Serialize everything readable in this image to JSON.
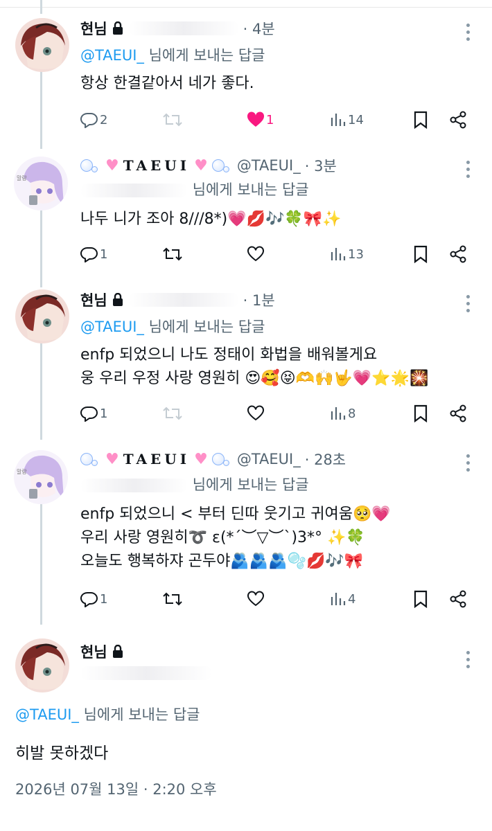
{
  "posts": [
    {
      "name": "현님",
      "time": "· 4분",
      "reply_to": "@TAEUI_",
      "reply_suffix": " 님에게 보내는 답글",
      "body": [
        "항상 한결같아서     네가 좋다."
      ],
      "replies": "2",
      "retweets": "",
      "likes": "1",
      "views": "14"
    },
    {
      "handle": "@TAEUI_",
      "time": "· 3분",
      "display_name": "TAEUI",
      "reply_suffix": "님에게 보내는 답글",
      "body": [
        "나두 니가 조아 8///8*)💗💋🎶🍀🎀✨"
      ],
      "replies": "1",
      "retweets": "",
      "likes": "",
      "views": "13"
    },
    {
      "name": "현님",
      "time": "· 1분",
      "reply_to": "@TAEUI_",
      "reply_suffix": " 님에게 보내는 답글",
      "body": [
        "enfp 되었으니 나도 정태이 화법을 배워볼게요",
        "웅 우리 우정 사랑 영원히 😍🥰😝🫶🙌🤟💗⭐🌟🎇"
      ],
      "replies": "1",
      "retweets": "",
      "likes": "",
      "views": "8"
    },
    {
      "handle": "@TAEUI_",
      "time": "· 28초",
      "display_name": "TAEUI",
      "reply_suffix": "님에게 보내는 답글",
      "body": [
        "enfp 되었으니 < 부터 딘따 웃기고 귀여움🥺💗",
        "우리 사랑 영원히➰ ε(*´︶▽︶`)3*° ✨🍀",
        "오늘도 행복하쟈 곤두야🫂🫂🫂🫧💋🎶🎀"
      ],
      "replies": "1",
      "retweets": "",
      "likes": "",
      "views": "4"
    }
  ],
  "main_post": {
    "name": "현님",
    "reply_to": "@TAEUI_",
    "reply_suffix": " 님에게 보내는 답글",
    "body": "히발 못하겠다",
    "date": "2026년 07월 13일 · 2:20 오후"
  },
  "colors": {
    "accent": "#1d9bf0",
    "like": "#f91880",
    "muted": "#536471",
    "thread_line": "#cfd9de"
  }
}
